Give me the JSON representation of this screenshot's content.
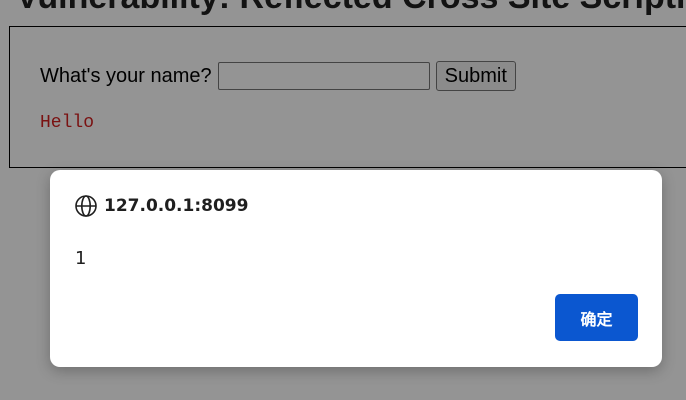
{
  "page": {
    "heading": "Vulnerability: Reflected Cross Site Scripting",
    "form": {
      "label": "What's your name?",
      "input_value": "",
      "submit_label": "Submit"
    },
    "greeting": "Hello"
  },
  "dialog": {
    "origin": "127.0.0.1:8099",
    "message": "1",
    "ok_label": "确定",
    "icon": "globe-icon",
    "ok_color": "#0b57d0"
  }
}
